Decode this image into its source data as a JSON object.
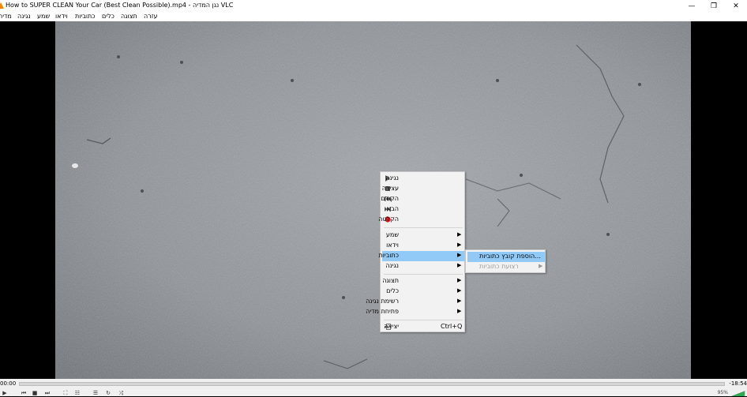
{
  "window": {
    "title": "How to SUPER CLEAN Your Car (Best Clean Possible).mp4 - נגן המדיה VLC",
    "minimize": "—",
    "restore": "❐",
    "close": "✕"
  },
  "menubar": [
    {
      "label": "מדיה",
      "icon": "menu-media"
    },
    {
      "label": "נגינה",
      "icon": "menu-playback"
    },
    {
      "label": "שמע",
      "icon": "menu-audio"
    },
    {
      "label": "וידאו",
      "icon": "menu-video"
    },
    {
      "label": "כתוביות",
      "icon": "menu-subtitle"
    },
    {
      "label": "כלים",
      "icon": "menu-tools"
    },
    {
      "label": "תצוגה",
      "icon": "menu-view"
    },
    {
      "label": "עזרה",
      "icon": "menu-help"
    }
  ],
  "context_menu": {
    "items": [
      {
        "label": "נגינה",
        "icon": "play-icon"
      },
      {
        "label": "עצירה",
        "icon": "stop-icon"
      },
      {
        "label": "הקודם",
        "icon": "previous-icon"
      },
      {
        "label": "הבא",
        "icon": "next-icon"
      },
      {
        "label": "הקלטה",
        "icon": "record-icon"
      },
      {
        "label": "שמע",
        "submenu": true
      },
      {
        "label": "וידאו",
        "submenu": true
      },
      {
        "label": "כתוביות",
        "submenu": true,
        "highlighted": true
      },
      {
        "label": "נגינה",
        "submenu": true
      },
      {
        "label": "תצוגה",
        "submenu": true
      },
      {
        "label": "כלים",
        "submenu": true
      },
      {
        "label": "רשימת נגינה",
        "submenu": true
      },
      {
        "label": "פתיחת מדיה",
        "submenu": true
      },
      {
        "label": "יציאה",
        "shortcut": "Ctrl+Q",
        "icon": "exit-icon"
      }
    ],
    "highlight_color": "#91c9f7"
  },
  "submenu": {
    "items": [
      {
        "label": "הוספת קובץ כתוביות...",
        "highlighted": true
      },
      {
        "label": "רצועת כתוביות",
        "disabled": true,
        "submenu": true
      }
    ]
  },
  "controls": {
    "time_elapsed": "00:00",
    "time_remaining": "-18:54",
    "volume": "95%",
    "buttons": [
      "play-icon",
      "previous-icon",
      "stop-icon",
      "next-icon",
      "fullscreen-icon",
      "extended-settings-icon",
      "playlist-icon",
      "loop-icon",
      "shuffle-icon"
    ]
  },
  "colors": {
    "accent": "#91c9f7",
    "record": "#e81123",
    "vlc_orange": "#f28a00"
  }
}
